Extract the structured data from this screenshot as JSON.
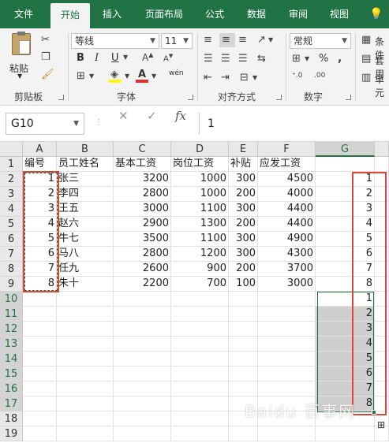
{
  "tabs": [
    {
      "label": "文件",
      "active": false
    },
    {
      "label": "开始",
      "active": true
    },
    {
      "label": "插入",
      "active": false
    },
    {
      "label": "页面布局",
      "active": false
    },
    {
      "label": "公式",
      "active": false
    },
    {
      "label": "数据",
      "active": false
    },
    {
      "label": "审阅",
      "active": false
    },
    {
      "label": "视图",
      "active": false
    }
  ],
  "ribbon": {
    "clipboard": {
      "paste_label": "粘贴",
      "group_label": "剪贴板"
    },
    "font": {
      "name": "等线",
      "size": "11",
      "group_label": "字体",
      "bold": "B",
      "italic": "I",
      "underline": "U",
      "font_color_a": "A",
      "phonetic": "wén"
    },
    "alignment": {
      "group_label": "对齐方式"
    },
    "number": {
      "format": "常规",
      "group_label": "数字",
      "percent": "%"
    },
    "styles": {
      "conditional": "条件",
      "table": "套用",
      "cell": "单元"
    },
    "accent_color": "#217346"
  },
  "formula_bar": {
    "name_box": "G10",
    "formula": "1",
    "fx": "fx"
  },
  "sheet": {
    "columns": [
      "A",
      "B",
      "C",
      "D",
      "E",
      "F",
      "G"
    ],
    "selected_column": "G",
    "rows": [
      [
        "编号",
        "员工姓名",
        "基本工资",
        "岗位工资",
        "补贴",
        "应发工资",
        ""
      ],
      [
        "1",
        "张三",
        "3200",
        "1000",
        "300",
        "4500",
        "1"
      ],
      [
        "2",
        "李四",
        "2800",
        "1000",
        "200",
        "4000",
        "2"
      ],
      [
        "3",
        "王五",
        "3000",
        "1100",
        "300",
        "4400",
        "3"
      ],
      [
        "4",
        "赵六",
        "2900",
        "1300",
        "200",
        "4400",
        "4"
      ],
      [
        "5",
        "牛七",
        "3500",
        "1100",
        "300",
        "4900",
        "5"
      ],
      [
        "6",
        "马八",
        "2800",
        "1200",
        "300",
        "4300",
        "6"
      ],
      [
        "7",
        "任九",
        "2600",
        "900",
        "200",
        "3700",
        "7"
      ],
      [
        "8",
        "朱十",
        "2200",
        "700",
        "100",
        "3000",
        "8"
      ],
      [
        "",
        "",
        "",
        "",
        "",
        "",
        "1"
      ],
      [
        "",
        "",
        "",
        "",
        "",
        "",
        "2"
      ],
      [
        "",
        "",
        "",
        "",
        "",
        "",
        "3"
      ],
      [
        "",
        "",
        "",
        "",
        "",
        "",
        "4"
      ],
      [
        "",
        "",
        "",
        "",
        "",
        "",
        "5"
      ],
      [
        "",
        "",
        "",
        "",
        "",
        "",
        "6"
      ],
      [
        "",
        "",
        "",
        "",
        "",
        "",
        "7"
      ],
      [
        "",
        "",
        "",
        "",
        "",
        "",
        "8"
      ],
      [
        "",
        "",
        "",
        "",
        "",
        "",
        ""
      ],
      [
        "",
        "",
        "",
        "",
        "",
        "",
        ""
      ]
    ],
    "row_numbers": [
      "1",
      "2",
      "3",
      "4",
      "5",
      "6",
      "7",
      "8",
      "9",
      "10",
      "11",
      "12",
      "13",
      "14",
      "15",
      "16",
      "17",
      "18",
      "19"
    ],
    "selected_rows": [
      "10",
      "11",
      "12",
      "13",
      "14",
      "15",
      "16",
      "17"
    ]
  }
}
